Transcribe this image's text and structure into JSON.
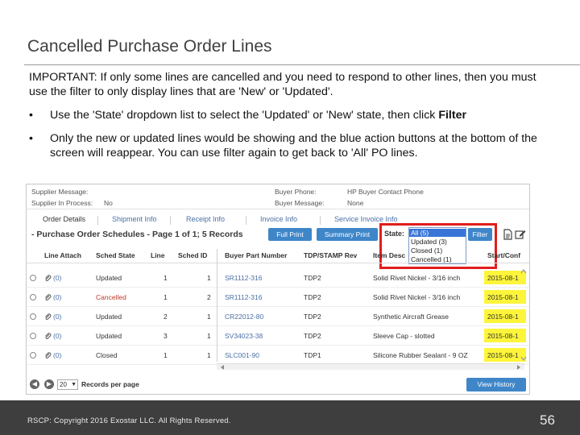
{
  "slide": {
    "title": "Cancelled Purchase Order Lines",
    "intro": "IMPORTANT:  If only some lines are cancelled and you need to respond to other lines, then you must use the filter to only display lines that are 'New' or 'Updated'.",
    "bullets": [
      {
        "marker": "•",
        "text_before": "Use the 'State' dropdown list to select the 'Updated' or 'New' state, then click ",
        "bold": "Filter"
      },
      {
        "marker": "•",
        "text_before": "Only the new or updated lines would be showing and the blue action buttons at the bottom of the screen will reappear.  You can use filter again to get back to 'All' PO lines.",
        "bold": ""
      }
    ],
    "footer": "RSCP: Copyright 2016 Exostar LLC. All Rights Reserved.",
    "page_number": "56"
  },
  "screenshot": {
    "info": {
      "supplier_message_label": "Supplier Message:",
      "supplier_in_process_label": "Supplier In Process:",
      "supplier_in_process_value": "No",
      "buyer_phone_label": "Buyer Phone:",
      "buyer_phone_value": "HP Buyer Contact Phone",
      "buyer_message_label": "Buyer Message:",
      "buyer_message_value": "None"
    },
    "tabs": [
      "Order Details",
      "Shipment Info",
      "Receipt Info",
      "Invoice Info",
      "Service Invoice Info"
    ],
    "schedules_title": "- Purchase Order Schedules - Page 1 of 1; 5 Records",
    "buttons": {
      "full_print": "Full Print",
      "summary_print": "Summary Print",
      "filter": "Filter",
      "view_history": "View History"
    },
    "state_label": "State:",
    "state_options": [
      "All (5)",
      "Updated (3)",
      "Closed (1)",
      "Cancelled (1)"
    ],
    "state_selected_index": 0,
    "columns": [
      "Line Attach",
      "Sched State",
      "Line",
      "Sched ID",
      "Buyer Part Number",
      "TDP/STAMP Rev",
      "Item Desc",
      "Start/Conf"
    ],
    "rows": [
      {
        "attach": "(0)",
        "state": "Updated",
        "line": "1",
        "sched_id": "1",
        "part": "SR1112-316",
        "rev": "TDP2",
        "desc": "Solid Rivet Nickel - 3/16 inch",
        "date": "2015-08-1"
      },
      {
        "attach": "(0)",
        "state": "Cancelled",
        "line": "1",
        "sched_id": "2",
        "part": "SR1112-316",
        "rev": "TDP2",
        "desc": "Solid Rivet Nickel - 3/16 inch",
        "date": "2015-08-1"
      },
      {
        "attach": "(0)",
        "state": "Updated",
        "line": "2",
        "sched_id": "1",
        "part": "CR22012-80",
        "rev": "TDP2",
        "desc": "Synthetic Aircraft Grease",
        "date": "2015-08-1"
      },
      {
        "attach": "(0)",
        "state": "Updated",
        "line": "3",
        "sched_id": "1",
        "part": "SV34023-38",
        "rev": "TDP2",
        "desc": "Sleeve Cap - slotted",
        "date": "2015-08-1"
      },
      {
        "attach": "(0)",
        "state": "Closed",
        "line": "1",
        "sched_id": "1",
        "part": "SLC001-90",
        "rev": "TDP1",
        "desc": "Silicone Rubber Sealant - 9 OZ",
        "date": "2015-08-1"
      }
    ],
    "pager": {
      "per_page_value": "20",
      "per_page_label": "Records per page"
    },
    "colors": {
      "highlight": "#fdf53a",
      "red_box": "#e11d1d",
      "button_blue": "#3f86c9",
      "cancelled_text": "#c0392b"
    }
  }
}
